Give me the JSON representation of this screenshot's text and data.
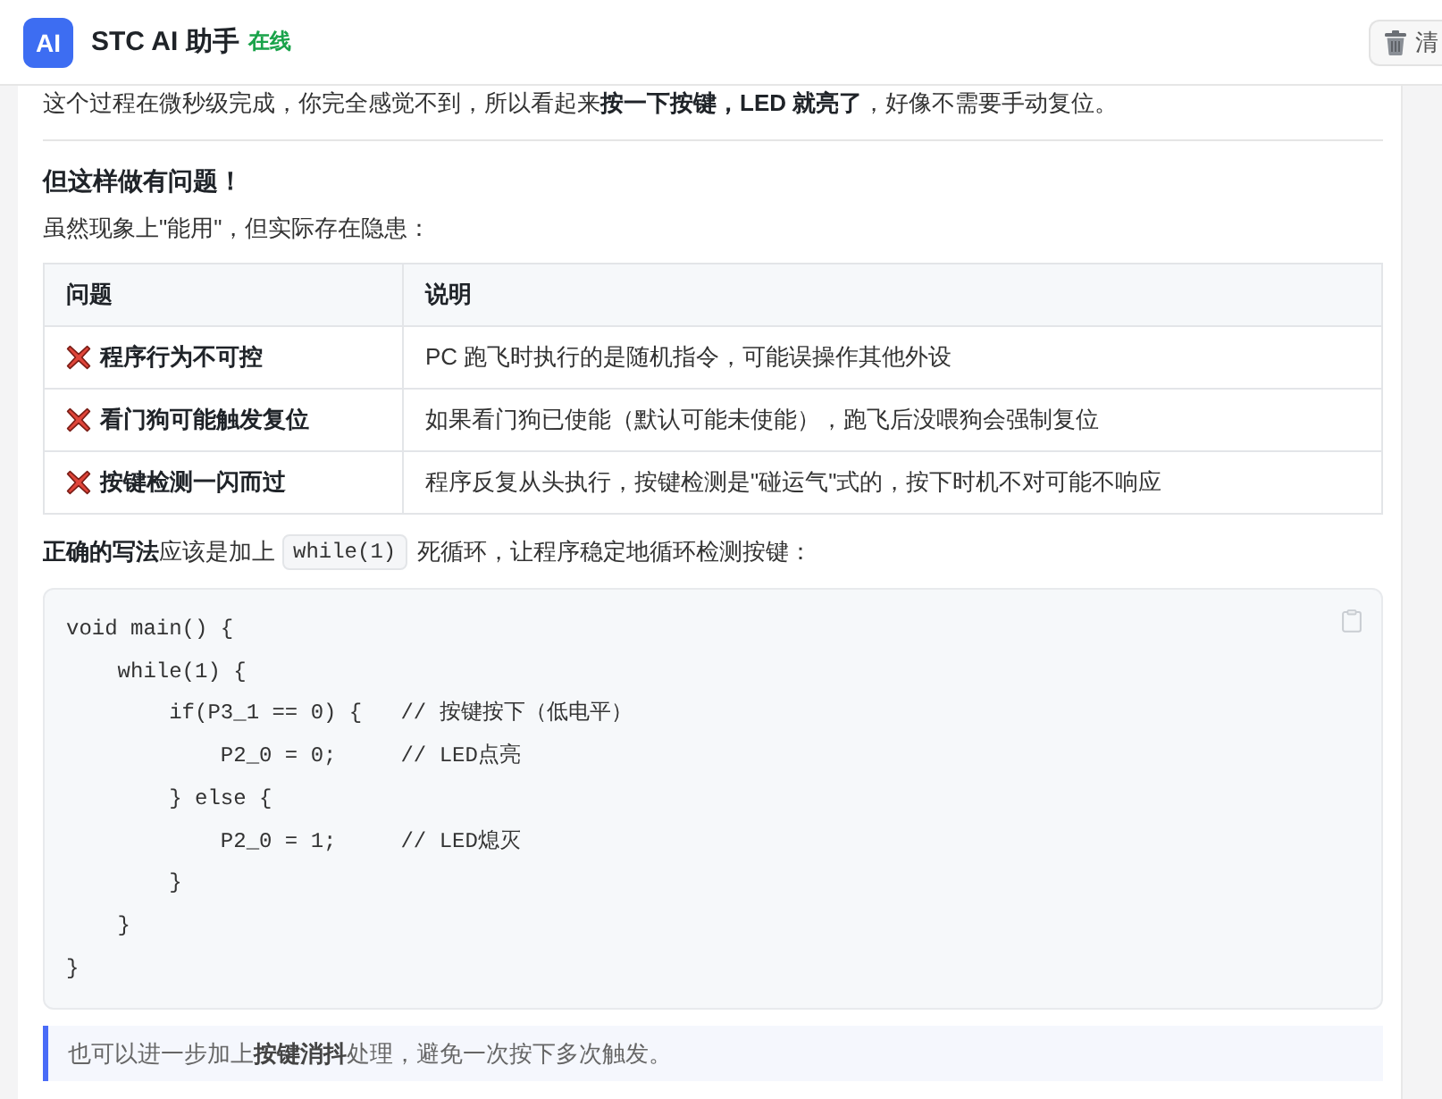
{
  "header": {
    "logo": "AI",
    "title": "STC AI 助手",
    "status": "在线",
    "clear_button": "清"
  },
  "message": {
    "intro": "这个过程在微秒级完成，你完全感觉不到，所以看起来**按一下按键，LED 就亮了**，好像不需要手动复位。",
    "heading": "但这样做有问题！",
    "lead": "虽然现象上\"能用\"，但实际存在隐患：",
    "table": {
      "columns": [
        "问题",
        "说明"
      ],
      "rows": [
        {
          "problem": "程序行为不可控",
          "explanation": "PC 跑飞时执行的是随机指令，可能误操作其他外设"
        },
        {
          "problem": "看门狗可能触发复位",
          "explanation": "如果看门狗已使能（默认可能未使能），跑飞后没喂狗会强制复位"
        },
        {
          "problem": "按键检测一闪而过",
          "explanation": "程序反复从头执行，按键检测是\"碰运气\"式的，按下时机不对可能不响应"
        }
      ]
    },
    "code_intro": {
      "before": "**正确的写法**应该是加上",
      "code": "while(1)",
      "after": "死循环，让程序稳定地循环检测按键："
    },
    "code_block": {
      "lines": [
        "void main() {",
        "    while(1) {",
        "        if(P3_1 == 0) {   // 按键按下（低电平）",
        "            P2_0 = 0;     // LED点亮",
        "        } else {",
        "            P2_0 = 1;     // LED熄灭",
        "        }",
        "    }",
        "}"
      ]
    },
    "note": "也可以进一步加上**按键消抖**处理，避免一次按下多次触发。"
  }
}
